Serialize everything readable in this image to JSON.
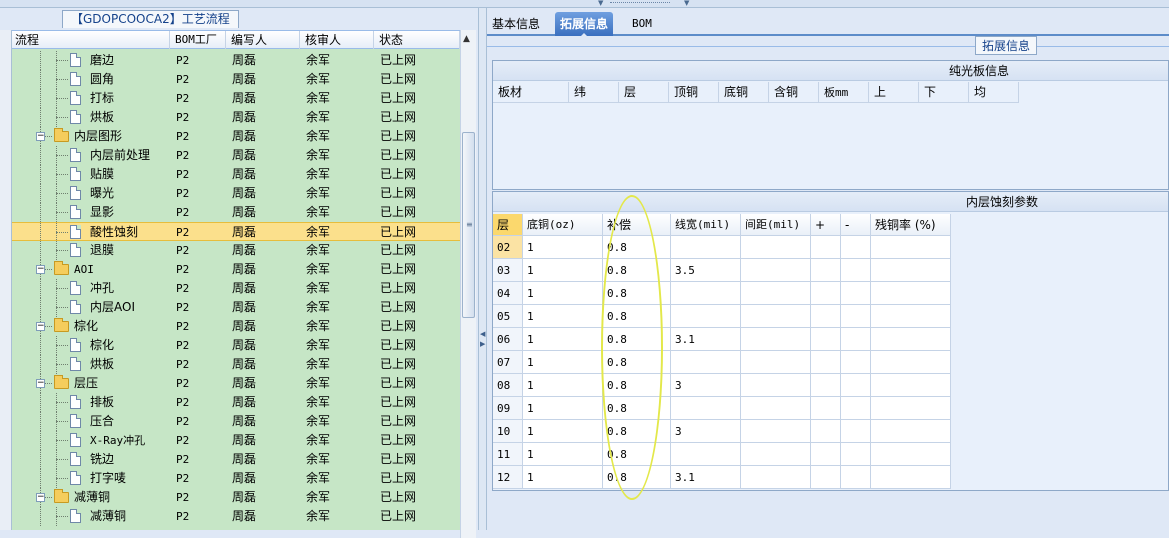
{
  "left_panel": {
    "title": "【GDOPCOOCA2】工艺流程",
    "columns": [
      "流程",
      "BOM工厂",
      "编写人",
      "核审人",
      "状态"
    ],
    "rows": [
      {
        "name": "磨边",
        "type": "doc",
        "level": 2,
        "factory": "P2",
        "author": "周磊",
        "reviewer": "余军",
        "status": "已上网",
        "selected": false
      },
      {
        "name": "圆角",
        "type": "doc",
        "level": 2,
        "factory": "P2",
        "author": "周磊",
        "reviewer": "余军",
        "status": "已上网",
        "selected": false
      },
      {
        "name": "打标",
        "type": "doc",
        "level": 2,
        "factory": "P2",
        "author": "周磊",
        "reviewer": "余军",
        "status": "已上网",
        "selected": false
      },
      {
        "name": "烘板",
        "type": "doc",
        "level": 2,
        "factory": "P2",
        "author": "周磊",
        "reviewer": "余军",
        "status": "已上网",
        "selected": false
      },
      {
        "name": "内层图形",
        "type": "folder",
        "level": 1,
        "factory": "P2",
        "author": "周磊",
        "reviewer": "余军",
        "status": "已上网",
        "selected": false
      },
      {
        "name": "内层前处理",
        "type": "doc",
        "level": 2,
        "factory": "P2",
        "author": "周磊",
        "reviewer": "余军",
        "status": "已上网",
        "selected": false
      },
      {
        "name": "贴膜",
        "type": "doc",
        "level": 2,
        "factory": "P2",
        "author": "周磊",
        "reviewer": "余军",
        "status": "已上网",
        "selected": false
      },
      {
        "name": "曝光",
        "type": "doc",
        "level": 2,
        "factory": "P2",
        "author": "周磊",
        "reviewer": "余军",
        "status": "已上网",
        "selected": false
      },
      {
        "name": "显影",
        "type": "doc",
        "level": 2,
        "factory": "P2",
        "author": "周磊",
        "reviewer": "余军",
        "status": "已上网",
        "selected": false
      },
      {
        "name": "酸性蚀刻",
        "type": "doc",
        "level": 2,
        "factory": "P2",
        "author": "周磊",
        "reviewer": "余军",
        "status": "已上网",
        "selected": true
      },
      {
        "name": "退膜",
        "type": "doc",
        "level": 2,
        "factory": "P2",
        "author": "周磊",
        "reviewer": "余军",
        "status": "已上网",
        "selected": false
      },
      {
        "name": "AOI",
        "type": "folder",
        "level": 1,
        "factory": "P2",
        "author": "周磊",
        "reviewer": "余军",
        "status": "已上网",
        "selected": false
      },
      {
        "name": "冲孔",
        "type": "doc",
        "level": 2,
        "factory": "P2",
        "author": "周磊",
        "reviewer": "余军",
        "status": "已上网",
        "selected": false
      },
      {
        "name": "内层AOI",
        "type": "doc",
        "level": 2,
        "factory": "P2",
        "author": "周磊",
        "reviewer": "余军",
        "status": "已上网",
        "selected": false
      },
      {
        "name": "棕化",
        "type": "folder",
        "level": 1,
        "factory": "P2",
        "author": "周磊",
        "reviewer": "余军",
        "status": "已上网",
        "selected": false
      },
      {
        "name": "棕化",
        "type": "doc",
        "level": 2,
        "factory": "P2",
        "author": "周磊",
        "reviewer": "余军",
        "status": "已上网",
        "selected": false
      },
      {
        "name": "烘板",
        "type": "doc",
        "level": 2,
        "factory": "P2",
        "author": "周磊",
        "reviewer": "余军",
        "status": "已上网",
        "selected": false
      },
      {
        "name": "层压",
        "type": "folder",
        "level": 1,
        "factory": "P2",
        "author": "周磊",
        "reviewer": "余军",
        "status": "已上网",
        "selected": false
      },
      {
        "name": "排板",
        "type": "doc",
        "level": 2,
        "factory": "P2",
        "author": "周磊",
        "reviewer": "余军",
        "status": "已上网",
        "selected": false
      },
      {
        "name": "压合",
        "type": "doc",
        "level": 2,
        "factory": "P2",
        "author": "周磊",
        "reviewer": "余军",
        "status": "已上网",
        "selected": false
      },
      {
        "name": "X-Ray冲孔",
        "type": "doc",
        "level": 2,
        "factory": "P2",
        "author": "周磊",
        "reviewer": "余军",
        "status": "已上网",
        "selected": false
      },
      {
        "name": "铣边",
        "type": "doc",
        "level": 2,
        "factory": "P2",
        "author": "周磊",
        "reviewer": "余军",
        "status": "已上网",
        "selected": false
      },
      {
        "name": "打字唛",
        "type": "doc",
        "level": 2,
        "factory": "P2",
        "author": "周磊",
        "reviewer": "余军",
        "status": "已上网",
        "selected": false
      },
      {
        "name": "减薄铜",
        "type": "folder",
        "level": 1,
        "factory": "P2",
        "author": "周磊",
        "reviewer": "余军",
        "status": "已上网",
        "selected": false
      },
      {
        "name": "减薄铜",
        "type": "doc",
        "level": 2,
        "factory": "P2",
        "author": "周磊",
        "reviewer": "余军",
        "status": "已上网",
        "selected": false
      }
    ]
  },
  "right_panel": {
    "tabs": [
      {
        "label": "基本信息",
        "active": false
      },
      {
        "label": "拓展信息",
        "active": true
      },
      {
        "label": "BOM",
        "active": false
      }
    ],
    "fieldset_legend": "拓展信息",
    "plain_board": {
      "title": "纯光板信息",
      "columns": [
        "板材",
        "纬",
        "层",
        "顶铜",
        "底铜",
        "含铜",
        "板mm",
        "上",
        "下",
        "均"
      ]
    },
    "etch_params": {
      "title": "内层蚀刻参数",
      "columns": [
        "层",
        "底铜(oz)",
        "补偿",
        "线宽(mil)",
        "间距(mil)",
        "+",
        "-",
        "残铜率 (%)"
      ],
      "rows": [
        [
          "02",
          "1",
          "0.8",
          "",
          "",
          "",
          "",
          ""
        ],
        [
          "03",
          "1",
          "0.8",
          "3.5",
          "",
          "",
          "",
          ""
        ],
        [
          "04",
          "1",
          "0.8",
          "",
          "",
          "",
          "",
          ""
        ],
        [
          "05",
          "1",
          "0.8",
          "",
          "",
          "",
          "",
          ""
        ],
        [
          "06",
          "1",
          "0.8",
          "3.1",
          "",
          "",
          "",
          ""
        ],
        [
          "07",
          "1",
          "0.8",
          "",
          "",
          "",
          "",
          ""
        ],
        [
          "08",
          "1",
          "0.8",
          "3",
          "",
          "",
          "",
          ""
        ],
        [
          "09",
          "1",
          "0.8",
          "",
          "",
          "",
          "",
          ""
        ],
        [
          "10",
          "1",
          "0.8",
          "3",
          "",
          "",
          "",
          ""
        ],
        [
          "11",
          "1",
          "0.8",
          "",
          "",
          "",
          "",
          ""
        ],
        [
          "12",
          "1",
          "0.8",
          "3.1",
          "",
          "",
          "",
          ""
        ]
      ]
    }
  },
  "annotation": {
    "color": "#e3e84a",
    "shape": "ellipse"
  },
  "colors": {
    "tree_bg": "#c6e6c6",
    "selected_row": "#fbe08c",
    "active_tab": "#3a6fbf"
  }
}
